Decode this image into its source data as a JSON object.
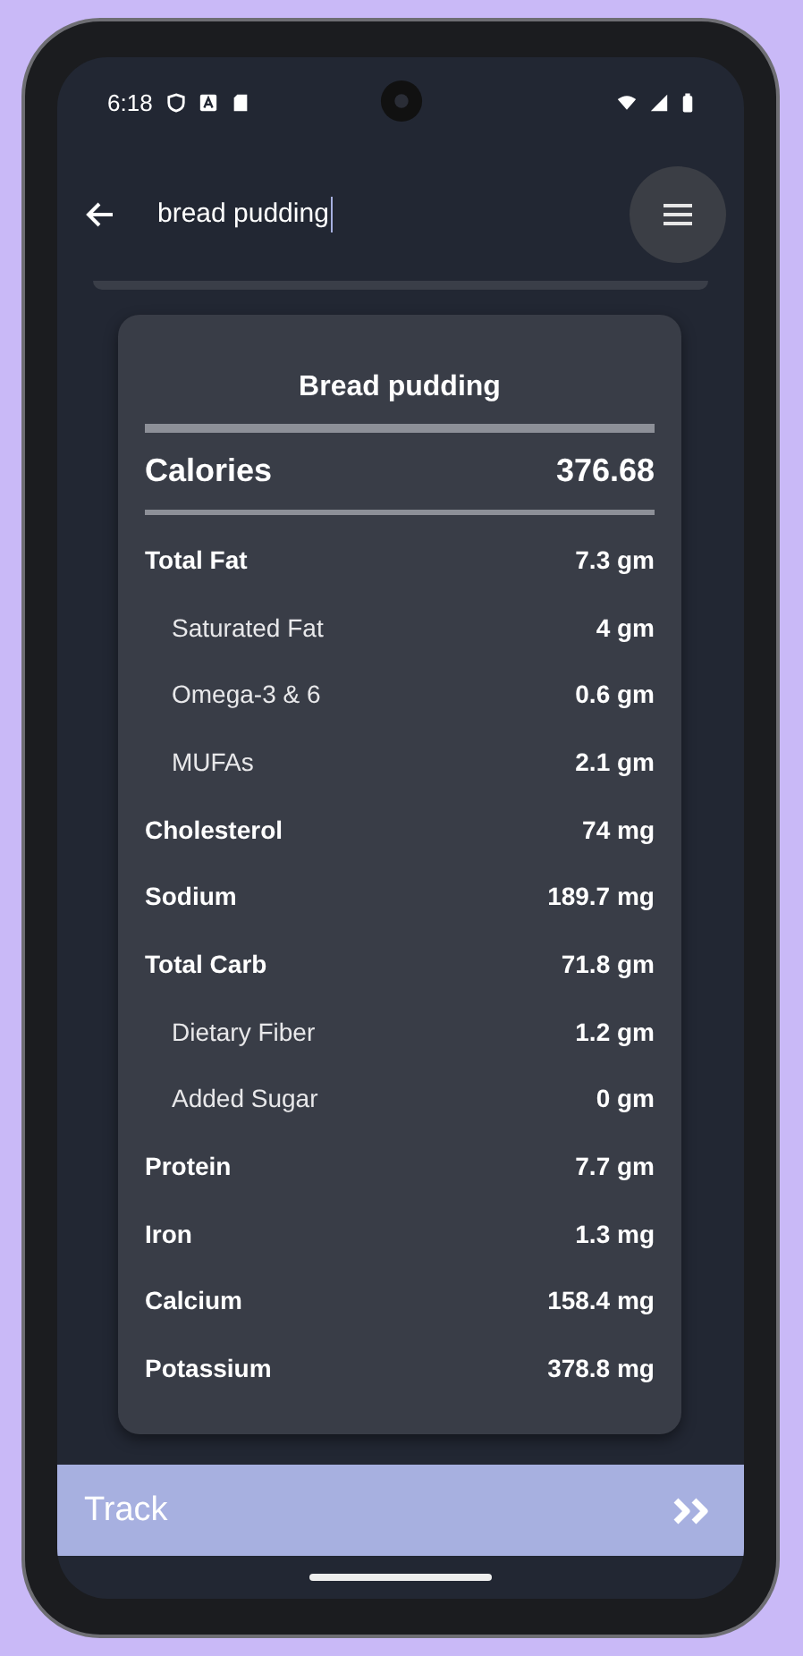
{
  "status_bar": {
    "time": "6:18"
  },
  "search": {
    "value": "bread pudding"
  },
  "food": {
    "title": "Bread pudding",
    "calories_label": "Calories",
    "calories_value": "376.68",
    "nutrients": [
      {
        "name": "Total Fat",
        "value": "7.3 gm",
        "kind": "main"
      },
      {
        "name": "Saturated Fat",
        "value": "4 gm",
        "kind": "sub"
      },
      {
        "name": "Omega-3 & 6",
        "value": "0.6 gm",
        "kind": "sub"
      },
      {
        "name": "MUFAs",
        "value": "2.1 gm",
        "kind": "sub"
      },
      {
        "name": "Cholesterol",
        "value": "74 mg",
        "kind": "main"
      },
      {
        "name": "Sodium",
        "value": "189.7 mg",
        "kind": "main"
      },
      {
        "name": "Total Carb",
        "value": "71.8 gm",
        "kind": "main"
      },
      {
        "name": "Dietary Fiber",
        "value": "1.2 gm",
        "kind": "sub"
      },
      {
        "name": "Added Sugar",
        "value": "0 gm",
        "kind": "sub"
      },
      {
        "name": "Protein",
        "value": "7.7 gm",
        "kind": "main"
      },
      {
        "name": "Iron",
        "value": "1.3 mg",
        "kind": "main"
      },
      {
        "name": "Calcium",
        "value": "158.4 mg",
        "kind": "main"
      },
      {
        "name": "Potassium",
        "value": "378.8 mg",
        "kind": "main"
      }
    ]
  },
  "track_button": {
    "label": "Track"
  }
}
